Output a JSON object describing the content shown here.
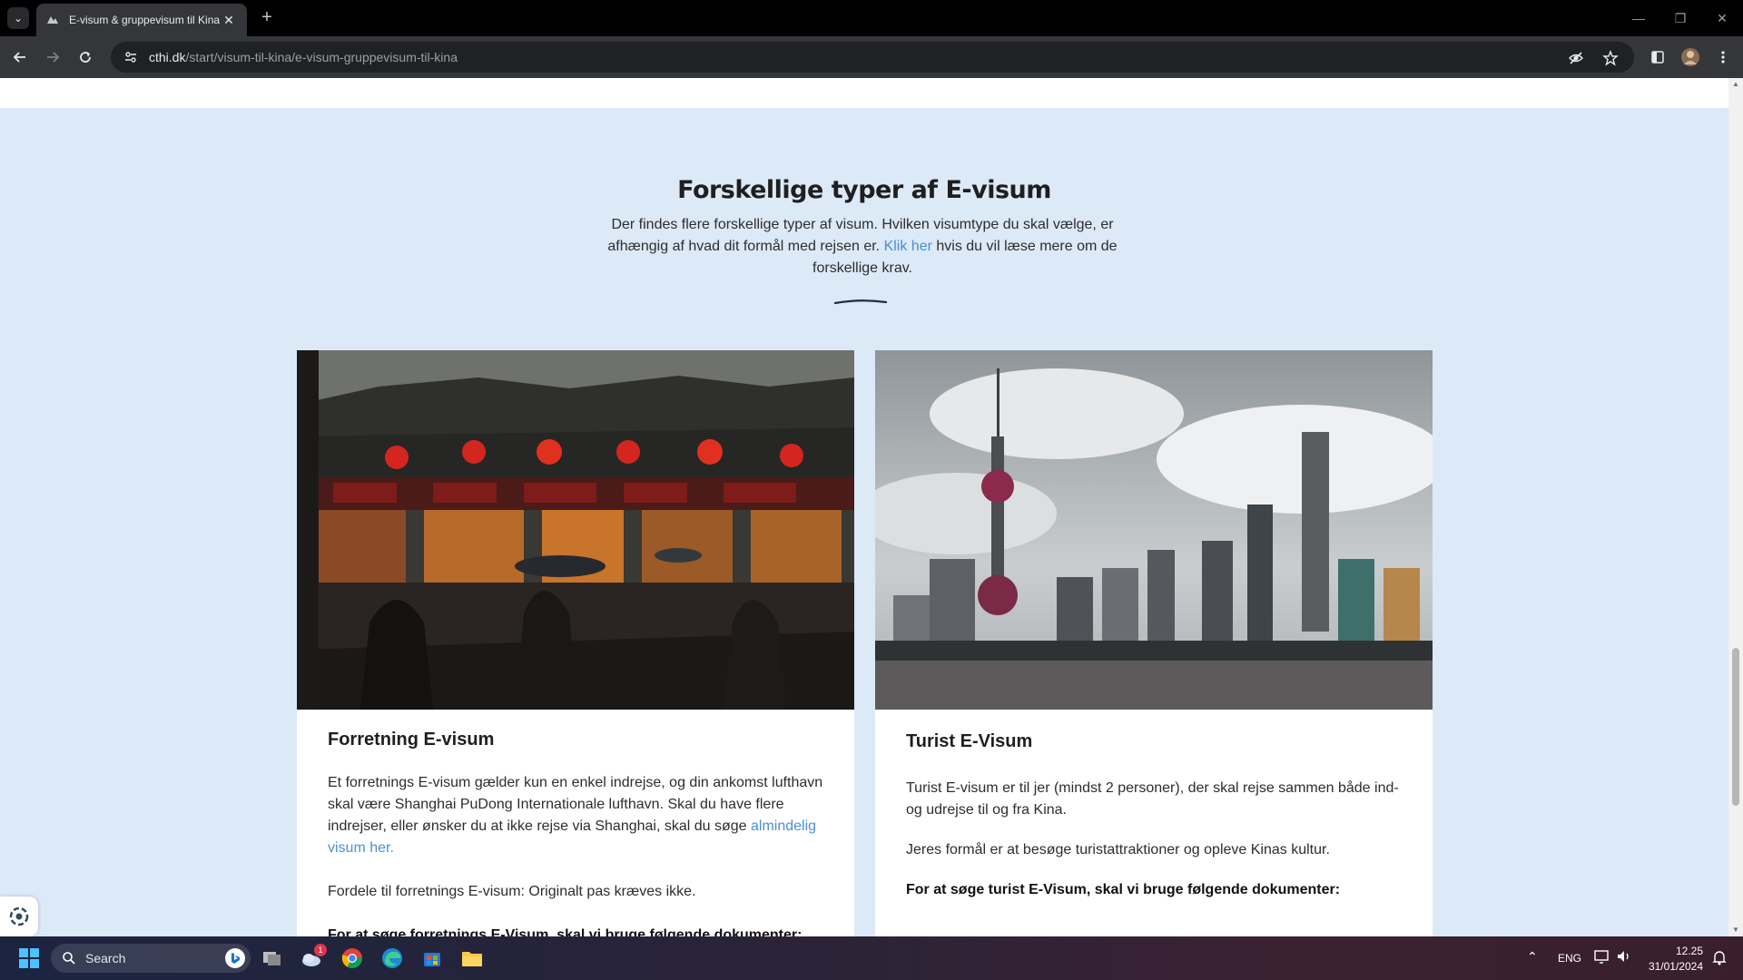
{
  "browser": {
    "tab_title": "E-visum & gruppevisum til Kina",
    "tab_close": "✕",
    "new_tab": "+",
    "url_host": "cthi.dk",
    "url_path": "/start/visum-til-kina/e-visum-gruppevisum-til-kina"
  },
  "section": {
    "title": "Forskellige typer af E-visum",
    "intro_before": "Der findes flere forskellige typer af visum. Hvilken visumtype du skal vælge, er afhængig af hvad dit formål med rejsen er. ",
    "intro_link": "Klik her",
    "intro_after": " hvis du vil læse mere om de forskellige krav."
  },
  "cards": [
    {
      "heading": "Forretning E-visum",
      "p1_before": "Et forretnings E-visum gælder kun en enkel indrejse, og din ankomst lufthavn skal være Shanghai PuDong Internationale lufthavn. Skal du have flere indrejser, eller ønsker du at ikke rejse via Shanghai, skal du søge ",
      "p1_link": "almindelig visum her.",
      "p2": "Fordele til forretnings E-visum: Originalt pas kræves ikke.",
      "p3_bold": "For at søge forretnings E-Visum, skal vi bruge følgende dokumenter:"
    },
    {
      "heading": "Turist E-Visum",
      "p1": "Turist E-visum er til jer (mindst 2 personer), der skal rejse sammen både ind- og udrejse til og fra Kina.",
      "p2": "Jeres formål er at besøge turistattraktioner og opleve Kinas kultur.",
      "p3_bold": "For at søge turist E-Visum, skal vi bruge følgende dokumenter:"
    }
  ],
  "taskbar": {
    "search_label": "Search",
    "language": "ENG",
    "time": "12.25",
    "date": "31/01/2024",
    "weather_badge": "1"
  },
  "colors": {
    "page_bg": "#dce9f7",
    "link": "#4a8fd4",
    "chrome_dark": "#35363a"
  }
}
